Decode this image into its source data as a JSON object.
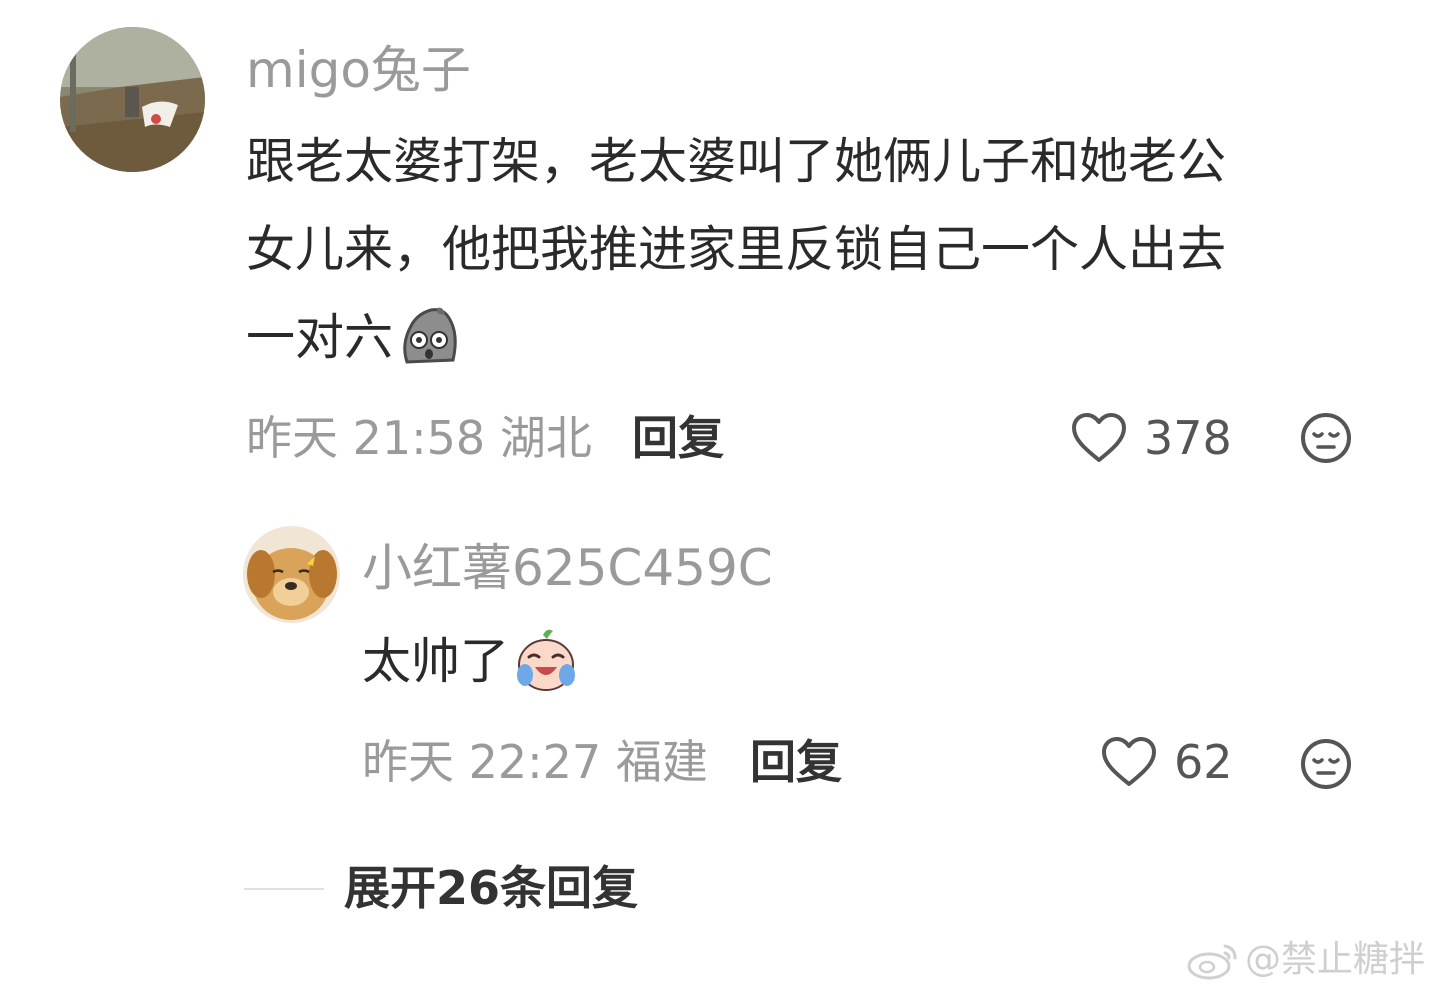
{
  "comment": {
    "username": "migo兔子",
    "text_line1": "跟老太婆打架，老太婆叫了她俩儿子和她老公",
    "text_line2": "女儿来，他把我推进家里反锁自己一个人出去",
    "text_line3": "一对六",
    "text_emoji": "rock-face-emoji",
    "time": "昨天 21:58",
    "location": "湖北",
    "reply_label": "回复",
    "likes": "378",
    "like_icon": "heart-icon",
    "dislike_icon": "meh-face-icon"
  },
  "sub_reply": {
    "username": "小红薯625C459C",
    "text": "太帅了",
    "text_emoji": "crying-laugh-emoji",
    "time": "昨天 22:27",
    "location": "福建",
    "reply_label": "回复",
    "likes": "62",
    "like_icon": "heart-icon",
    "dislike_icon": "meh-face-icon"
  },
  "expand_label": "展开26条回复",
  "watermark": "@禁止糖拌"
}
